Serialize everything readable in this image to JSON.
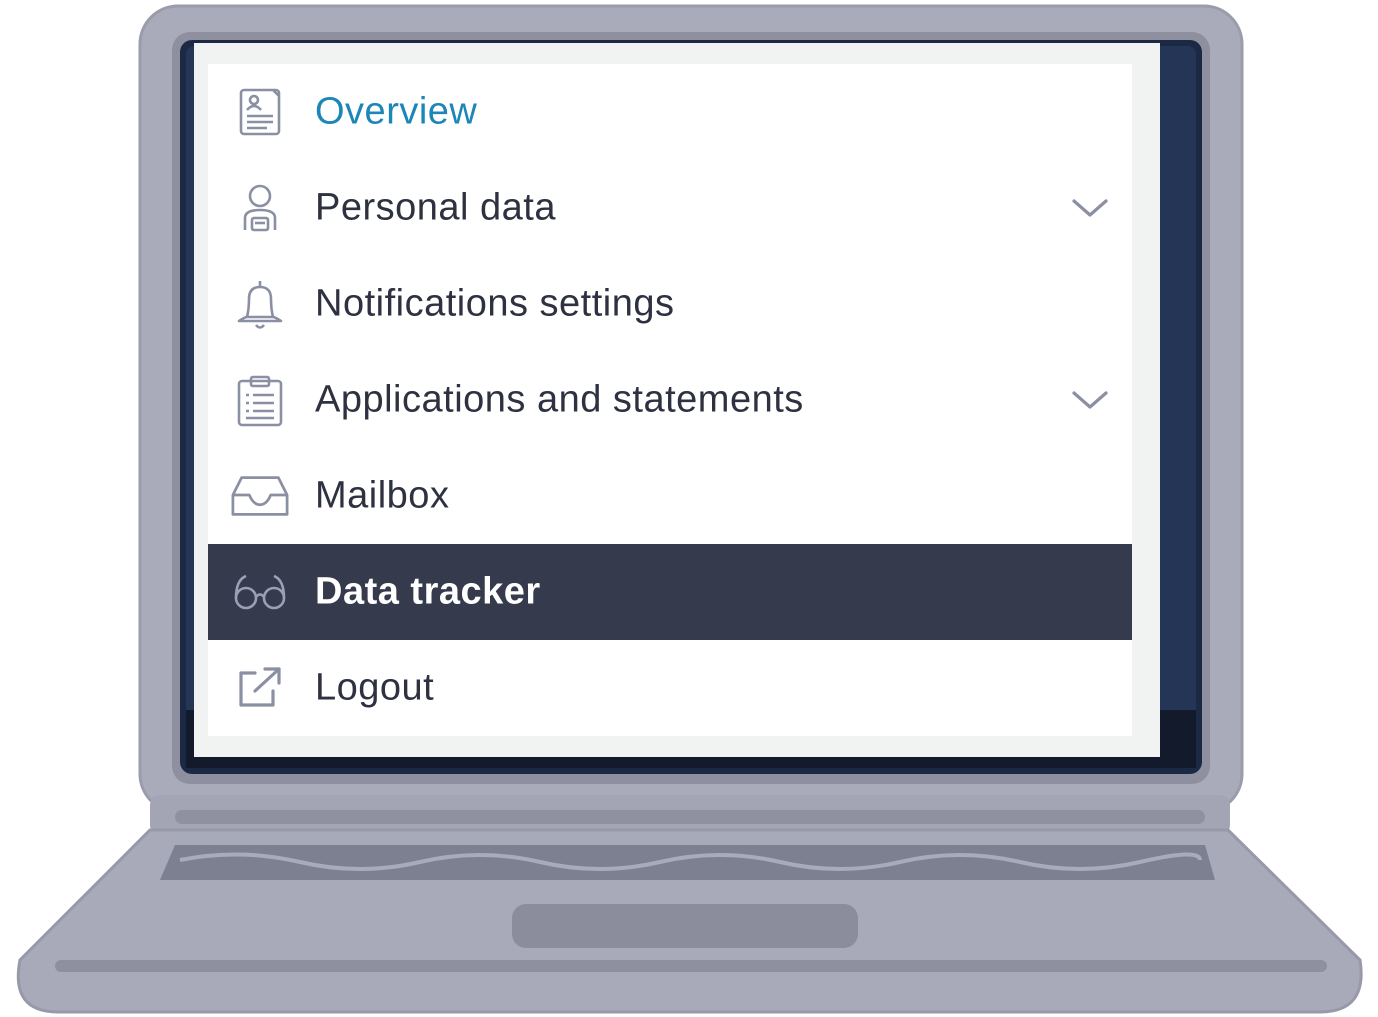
{
  "colors": {
    "link": "#1d86b8",
    "text": "#2d3140",
    "active_bg": "#363a4d",
    "active_text": "#ffffff",
    "icon": "#8a8fa3",
    "laptop_body": "#a7a9b8",
    "laptop_bezel": "#1f2b45"
  },
  "menu": {
    "items": [
      {
        "label": "Overview",
        "icon": "document-icon",
        "state": "link"
      },
      {
        "label": "Personal data",
        "icon": "person-icon",
        "expandable": true
      },
      {
        "label": "Notifications settings",
        "icon": "bell-icon"
      },
      {
        "label": "Applications and statements",
        "icon": "clipboard-icon",
        "expandable": true
      },
      {
        "label": "Mailbox",
        "icon": "inbox-icon"
      },
      {
        "label": "Data tracker",
        "icon": "glasses-icon",
        "state": "active"
      },
      {
        "label": "Logout",
        "icon": "external-link-icon"
      }
    ]
  }
}
